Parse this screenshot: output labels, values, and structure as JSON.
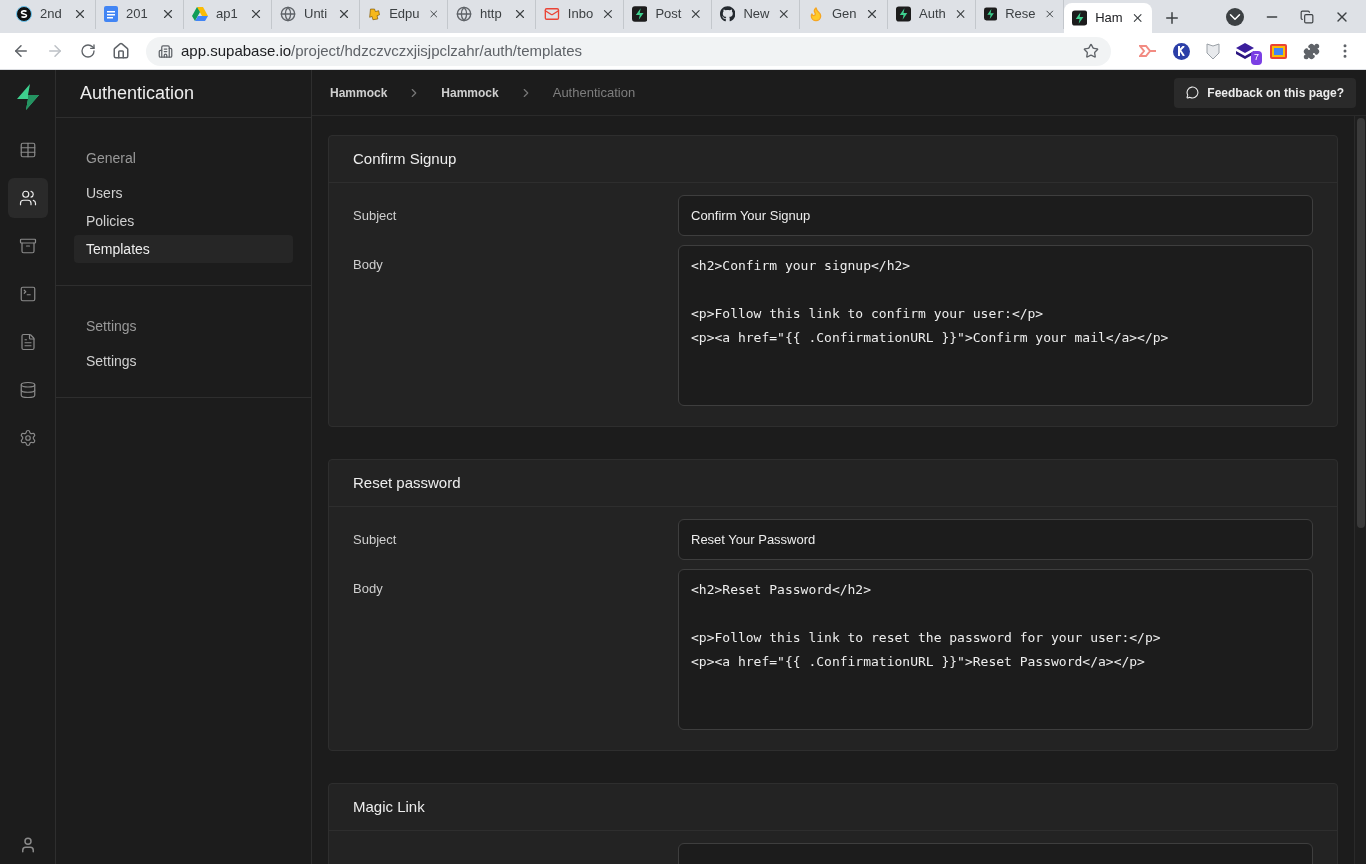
{
  "browser": {
    "tabs": [
      {
        "title": "2nd",
        "kind": "circle-s",
        "selected": false
      },
      {
        "title": "201",
        "kind": "docs",
        "selected": false
      },
      {
        "title": "ap1",
        "kind": "drive",
        "selected": false
      },
      {
        "title": "Unti",
        "kind": "globe",
        "selected": false
      },
      {
        "title": "Edpu",
        "kind": "puzzle",
        "selected": false
      },
      {
        "title": "http",
        "kind": "globe",
        "selected": false
      },
      {
        "title": "Inbo",
        "kind": "mail",
        "selected": false
      },
      {
        "title": "Post",
        "kind": "bolt",
        "selected": false
      },
      {
        "title": "New",
        "kind": "github",
        "selected": false
      },
      {
        "title": "Gen",
        "kind": "flame",
        "selected": false
      },
      {
        "title": "Auth",
        "kind": "bolt",
        "selected": false
      },
      {
        "title": "Rese",
        "kind": "bolt",
        "selected": false
      },
      {
        "title": "Ham",
        "kind": "bolt",
        "selected": true
      }
    ],
    "url_host": "app.supabase.io",
    "url_path": "/project/hdzczvczxjisjpclzahr/auth/templates",
    "extension_badge": "7"
  },
  "nav_rail": [
    {
      "kind": "table",
      "selected": false
    },
    {
      "kind": "users",
      "selected": true
    },
    {
      "kind": "archive",
      "selected": false
    },
    {
      "kind": "terminal",
      "selected": false
    },
    {
      "kind": "file",
      "selected": false
    },
    {
      "kind": "database",
      "selected": false
    },
    {
      "kind": "settings",
      "selected": false
    }
  ],
  "sidebar": {
    "title": "Authentication",
    "sections": [
      {
        "heading": "General",
        "items": [
          {
            "label": "Users",
            "selected": false
          },
          {
            "label": "Policies",
            "selected": false
          },
          {
            "label": "Templates",
            "selected": true
          }
        ]
      },
      {
        "heading": "Settings",
        "items": [
          {
            "label": "Settings",
            "selected": false
          }
        ]
      }
    ]
  },
  "breadcrumbs": [
    {
      "label": "Hammock",
      "current": false
    },
    {
      "label": "Hammock",
      "current": false
    },
    {
      "label": "Authentication",
      "current": true
    }
  ],
  "feedback_button": "Feedback on this page?",
  "templates": [
    {
      "title": "Confirm Signup",
      "subject_label": "Subject",
      "subject": "Confirm Your Signup",
      "body_label": "Body",
      "body": "<h2>Confirm your signup</h2>\n\n<p>Follow this link to confirm your user:</p>\n<p><a href=\"{{ .ConfirmationURL }}\">Confirm your mail</a></p>"
    },
    {
      "title": "Reset password",
      "subject_label": "Subject",
      "subject": "Reset Your Password",
      "body_label": "Body",
      "body": "<h2>Reset Password</h2>\n\n<p>Follow this link to reset the password for your user:</p>\n<p><a href=\"{{ .ConfirmationURL }}\">Reset Password</a></p>"
    },
    {
      "title": "Magic Link"
    }
  ]
}
